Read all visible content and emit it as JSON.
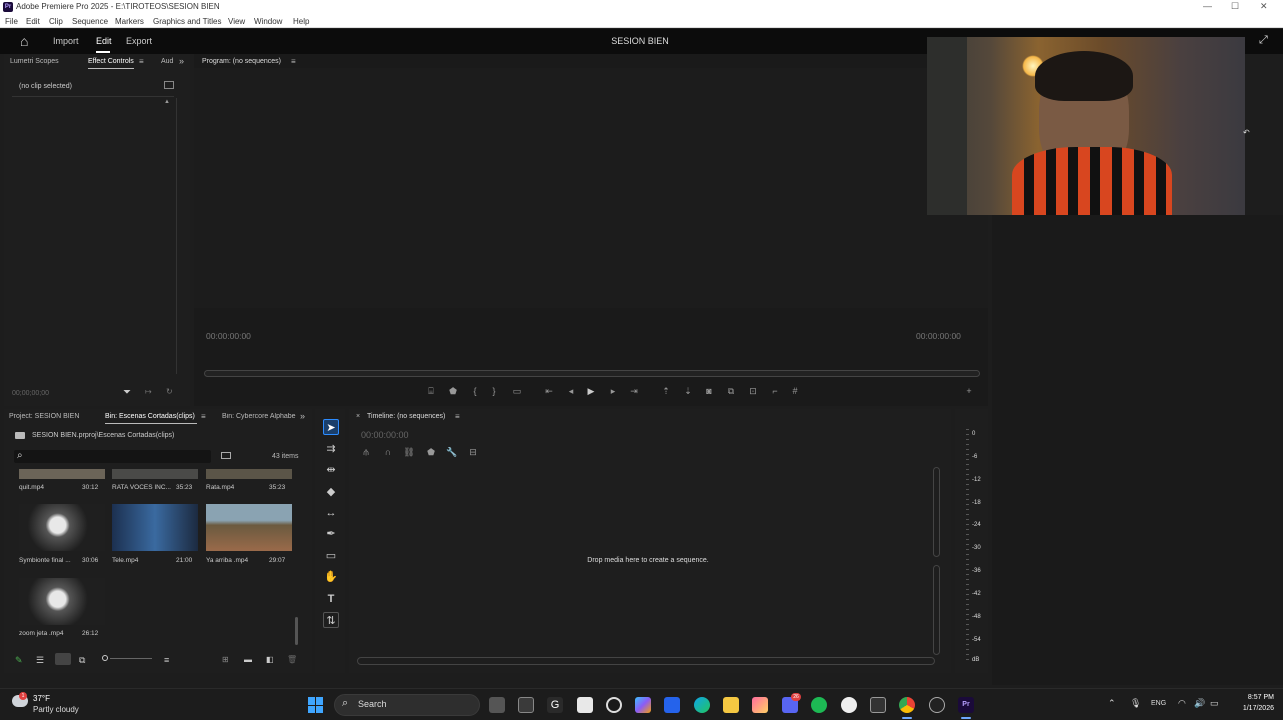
{
  "titlebar": {
    "app_title": "Adobe Premiere Pro 2025 - E:\\TIROTEOS\\SESION BIEN",
    "logo": "Pr",
    "minimize": "—",
    "maximize": "☐",
    "close": "✕"
  },
  "menu": [
    "File",
    "Edit",
    "Clip",
    "Sequence",
    "Markers",
    "Graphics and Titles",
    "View",
    "Window",
    "Help"
  ],
  "header": {
    "tabs": [
      "Import",
      "Edit",
      "Export"
    ],
    "active_tab": "Edit",
    "project_title": "SESION BIEN"
  },
  "source_panel": {
    "tabs": [
      "Lumetri Scopes",
      "Effect Controls",
      "Aud"
    ],
    "active_tab": "Effect Controls",
    "no_clip": "(no clip selected)",
    "timecode": "00;00;00;00"
  },
  "program_monitor": {
    "title": "Program: (no sequences)",
    "timecode_left": "00:00:00:00",
    "timecode_right": "00:00:00:00"
  },
  "project_panel": {
    "tabs": [
      "Project: SESION BIEN",
      "Bin: Escenas Cortadas(clips)",
      "Bin: Cybercore Alphabe"
    ],
    "active_tab": "Bin: Escenas Cortadas(clips)",
    "path": "SESION BIEN.prproj\\Escenas Cortadas(clips)",
    "search_placeholder": "",
    "item_count": "43 items",
    "clips": [
      {
        "name": "quit.mp4",
        "duration": "30:12"
      },
      {
        "name": "RATA VOCES INC...",
        "duration": "35:23"
      },
      {
        "name": "Rata.mp4",
        "duration": "35:23"
      },
      {
        "name": "Symbionte final ...",
        "duration": "30:06"
      },
      {
        "name": "Tele.mp4",
        "duration": "21:00"
      },
      {
        "name": "Ya arriba .mp4",
        "duration": "29:07"
      },
      {
        "name": "zoom jeta .mp4",
        "duration": "26:12"
      }
    ]
  },
  "timeline": {
    "title": "Timeline: (no sequences)",
    "timecode": "00:00:00:00",
    "drop_message": "Drop media here to create a sequence."
  },
  "audio_meter": {
    "labels": [
      "0",
      "-6",
      "-12",
      "-18",
      "-24",
      "-30",
      "-36",
      "-42",
      "-48",
      "-54",
      "dB"
    ]
  },
  "taskbar": {
    "weather_temp": "37°F",
    "weather_desc": "Partly cloudy",
    "search_label": "Search",
    "lang": "ENG",
    "time": "8:57 PM",
    "date": "1/17/2026",
    "discord_badge": "26"
  },
  "icons": {
    "home": "⌂",
    "menu": "≡",
    "chevrons": "»",
    "filter": "▼",
    "play": "▶",
    "plus": "+",
    "selection": "▲",
    "pen": "✒",
    "hand": "✋",
    "type": "T",
    "rect": "▭",
    "razor": "◆"
  },
  "colors": {
    "accent_blue": "#2d8cff",
    "tool_active": "#2d8cff",
    "clip_label_green": "#4caf50"
  }
}
